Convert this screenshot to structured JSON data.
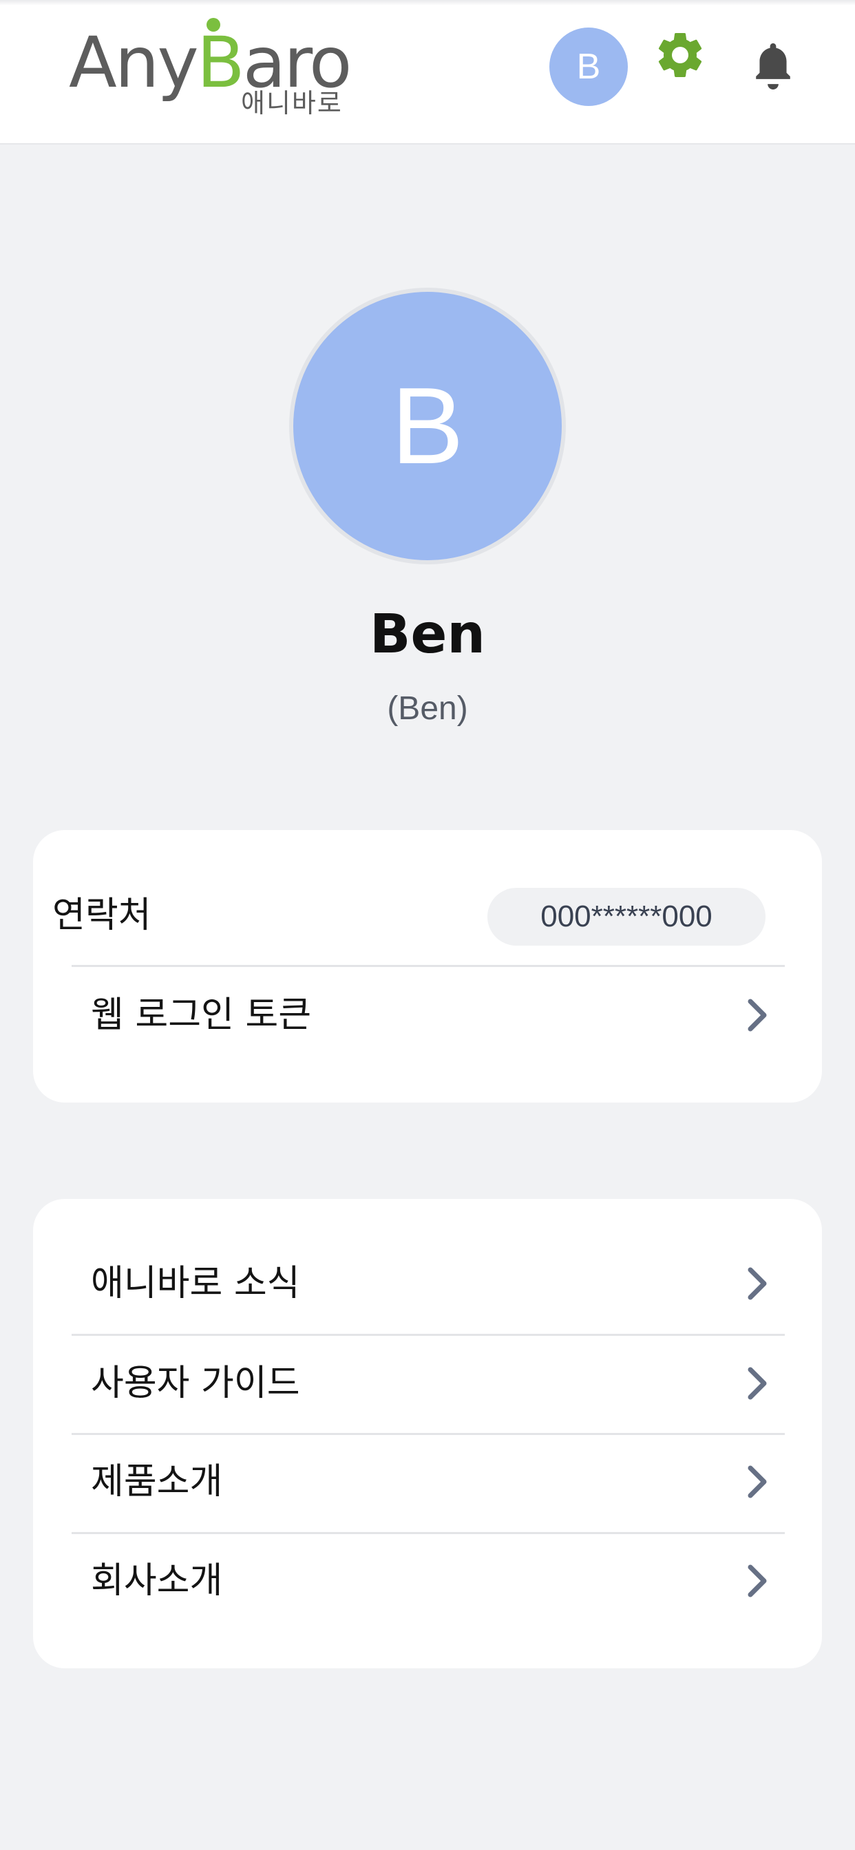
{
  "header": {
    "logo_text_left": "Any",
    "logo_text_accent": "B",
    "logo_text_right": "aro",
    "logo_korean": "애니바로",
    "avatar_initial": "B",
    "icons": [
      "gear-icon",
      "bell-icon"
    ],
    "accent_color": "#7bbf3f",
    "avatar_color": "#9cb9f1"
  },
  "profile": {
    "initial": "B",
    "name": "Ben",
    "subtitle": "(Ben)"
  },
  "account_card": {
    "contact_label": "연락처",
    "contact_value": "000******000",
    "web_token_label": "웹 로그인 토큰"
  },
  "info_card": {
    "items": [
      {
        "label": "애니바로 소식"
      },
      {
        "label": "사용자 가이드"
      },
      {
        "label": "제품소개"
      },
      {
        "label": "회사소개"
      }
    ]
  }
}
